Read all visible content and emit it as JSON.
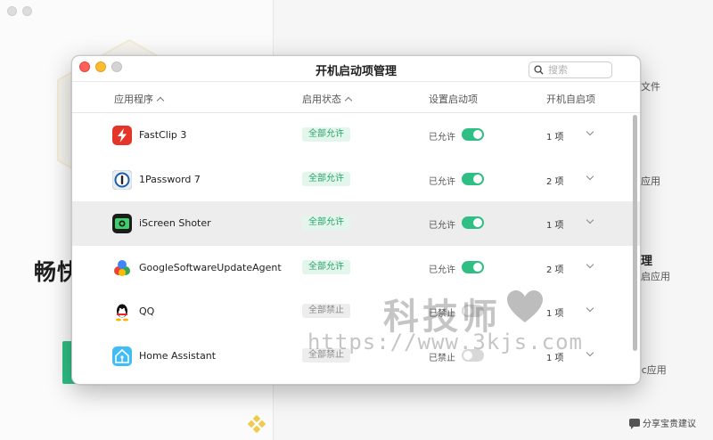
{
  "background": {
    "headline": "畅快",
    "right_labels": [
      "文件",
      "应用",
      "理",
      "启应用",
      "ac应用"
    ],
    "feedback": "分享宝贵建议"
  },
  "dialog": {
    "title": "开机启动项管理",
    "search_placeholder": "搜索",
    "columns": {
      "app": "应用程序",
      "status": "启用状态",
      "setting": "设置启动项",
      "autostart": "开机自启项"
    },
    "rows": [
      {
        "name": "FastClip 3",
        "icon": "fastclip-icon",
        "status": "全部允许",
        "status_type": "allow",
        "setting": "已允许",
        "toggle": "on",
        "count": "1 项"
      },
      {
        "name": "1Password 7",
        "icon": "onepassword-icon",
        "status": "全部允许",
        "status_type": "allow",
        "setting": "已允许",
        "toggle": "on",
        "count": "2 项"
      },
      {
        "name": "iScreen Shoter",
        "icon": "iscreen-shoter-icon",
        "status": "全部允许",
        "status_type": "allow",
        "setting": "已允许",
        "toggle": "on",
        "count": "1 项"
      },
      {
        "name": "GoogleSoftwareUpdateAgent",
        "icon": "google-update-icon",
        "status": "全部允许",
        "status_type": "allow",
        "setting": "已允许",
        "toggle": "on",
        "count": "2 项"
      },
      {
        "name": "QQ",
        "icon": "qq-icon",
        "status": "全部禁止",
        "status_type": "deny",
        "setting": "已禁止",
        "toggle": "off",
        "count": "1 项"
      },
      {
        "name": "Home Assistant",
        "icon": "home-assistant-icon",
        "status": "全部禁止",
        "status_type": "deny",
        "setting": "已禁止",
        "toggle": "off",
        "count": "1 项"
      }
    ],
    "selected_row": 2
  },
  "watermark": {
    "line1": "科技师",
    "line2": "https://www.3kjs.com"
  },
  "colors": {
    "accent_green": "#2fbf85",
    "allow_badge_bg": "#e3f6ec",
    "allow_badge_text": "#2ca36a",
    "deny_badge_bg": "#ededed"
  }
}
